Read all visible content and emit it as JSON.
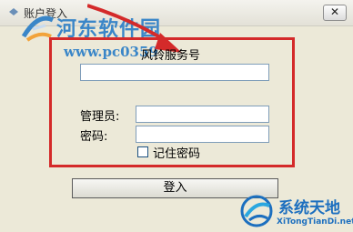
{
  "window": {
    "title": "账户登入",
    "close_label": "✕",
    "title_icon": "app-icon"
  },
  "form": {
    "account_label": "风铃服务号",
    "account_value": "",
    "manager_label": "管理员:",
    "manager_value": "",
    "password_label": "密码:",
    "password_value": "",
    "remember_label": "记住密码",
    "remember_checked": false,
    "login_label": "登入"
  },
  "watermarks": {
    "site_name": "河东软件园",
    "site_url": "www.pc0359",
    "brand_name": "系统天地",
    "brand_url": "XiTongTianDi.net"
  },
  "annotation": {
    "frame_color": "#d42a2a",
    "arrow_color": "#d42a2a"
  }
}
